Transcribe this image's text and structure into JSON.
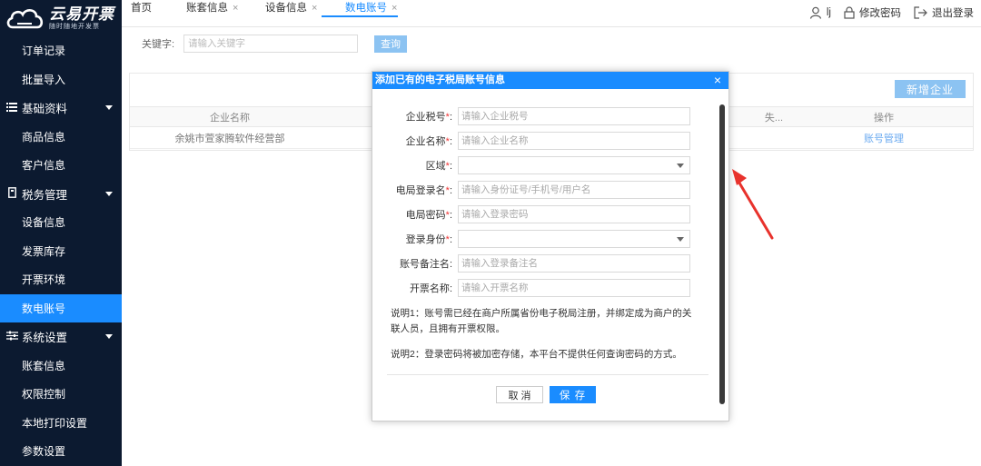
{
  "logo": {
    "title": "云易开票",
    "subtitle": "随时随地开发票"
  },
  "sidebar": {
    "items": [
      {
        "type": "item",
        "label": "订单记录"
      },
      {
        "type": "item",
        "label": "批量导入"
      },
      {
        "type": "group",
        "label": "基础资料",
        "icon": "list-icon"
      },
      {
        "type": "item",
        "label": "商品信息"
      },
      {
        "type": "item",
        "label": "客户信息"
      },
      {
        "type": "group",
        "label": "税务管理",
        "icon": "file-icon"
      },
      {
        "type": "item",
        "label": "设备信息"
      },
      {
        "type": "item",
        "label": "发票库存"
      },
      {
        "type": "item",
        "label": "开票环境"
      },
      {
        "type": "item",
        "label": "数电账号",
        "active": true
      },
      {
        "type": "group",
        "label": "系统设置",
        "icon": "sliders-icon"
      },
      {
        "type": "item",
        "label": "账套信息"
      },
      {
        "type": "item",
        "label": "权限控制"
      },
      {
        "type": "item",
        "label": "本地打印设置"
      },
      {
        "type": "item",
        "label": "参数设置"
      }
    ]
  },
  "tabs": [
    {
      "label": "首页",
      "closable": false
    },
    {
      "label": "账套信息",
      "closable": true,
      "close": "×"
    },
    {
      "label": "设备信息",
      "closable": true,
      "close": "×"
    },
    {
      "label": "数电账号",
      "closable": true,
      "close": "×",
      "active": true
    }
  ],
  "header": {
    "user_label": "lj",
    "change_password": "修改密码",
    "logout": "退出登录"
  },
  "search": {
    "label": "关键字:",
    "placeholder": "请输入关键字",
    "button": "查询"
  },
  "table": {
    "new_button": "新增企业",
    "headers": [
      "企业名称",
      "失...",
      "操作"
    ],
    "rows": [
      {
        "company": "余姚市萱家腾软件经营部",
        "action": "账号管理"
      }
    ]
  },
  "modal": {
    "title": "添加已有的电子税局账号信息",
    "close": "×",
    "fields": [
      {
        "label": "企业税号",
        "required": "*",
        "colon": ":",
        "placeholder": "请输入企业税号",
        "kind": "input"
      },
      {
        "label": "企业名称",
        "required": "*",
        "colon": ":",
        "placeholder": "请输入企业名称",
        "kind": "input"
      },
      {
        "label": "区域",
        "required": "*",
        "colon": ":",
        "placeholder": "",
        "kind": "select"
      },
      {
        "label": "电局登录名",
        "required": "*",
        "colon": ":",
        "placeholder": "请输入身份证号/手机号/用户名",
        "kind": "input"
      },
      {
        "label": "电局密码",
        "required": "*",
        "colon": ":",
        "placeholder": "请输入登录密码",
        "kind": "input"
      },
      {
        "label": "登录身份",
        "required": "*",
        "colon": ":",
        "placeholder": "",
        "kind": "select"
      },
      {
        "label": "账号备注名",
        "required": "",
        "colon": ":",
        "placeholder": "请输入登录备注名",
        "kind": "input"
      },
      {
        "label": "开票名称",
        "required": "",
        "colon": ":",
        "placeholder": "请输入开票名称",
        "kind": "input"
      }
    ],
    "note1": "说明1：账号需已经在商户所属省份电子税局注册，并绑定成为商户的关联人员，且拥有开票权限。",
    "note2": "说明2：登录密码将被加密存储，本平台不提供任何查询密码的方式。",
    "cancel": "取 消",
    "save": "保 存"
  },
  "colors": {
    "sidebar_bg": "#0c1a30",
    "accent": "#1a8cff",
    "disabled_button": "#8cc3f2",
    "required": "#e33333",
    "arrow": "#e8322c"
  }
}
